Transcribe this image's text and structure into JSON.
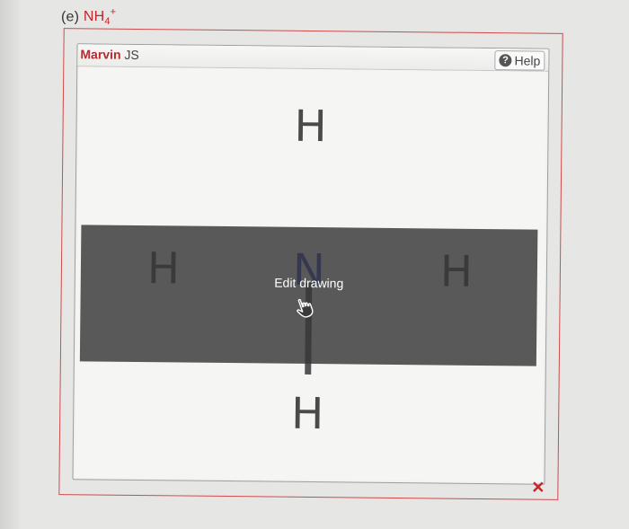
{
  "question": {
    "prefix": "(e)",
    "formula_base": "NH",
    "formula_subscript": "4",
    "formula_charge": "+"
  },
  "editor": {
    "brand_name": "Marvin",
    "brand_suffix": "JS",
    "help_label": "Help",
    "overlay_label": "Edit drawing",
    "remove_symbol": "✕"
  },
  "molecule": {
    "atoms": {
      "center": "N",
      "top": "H",
      "left": "H",
      "right": "H",
      "bottom": "H"
    }
  },
  "colors": {
    "accent_red": "#c0262c",
    "nitrogen_blue": "#2b3fc4",
    "bond_gray": "#555555"
  }
}
